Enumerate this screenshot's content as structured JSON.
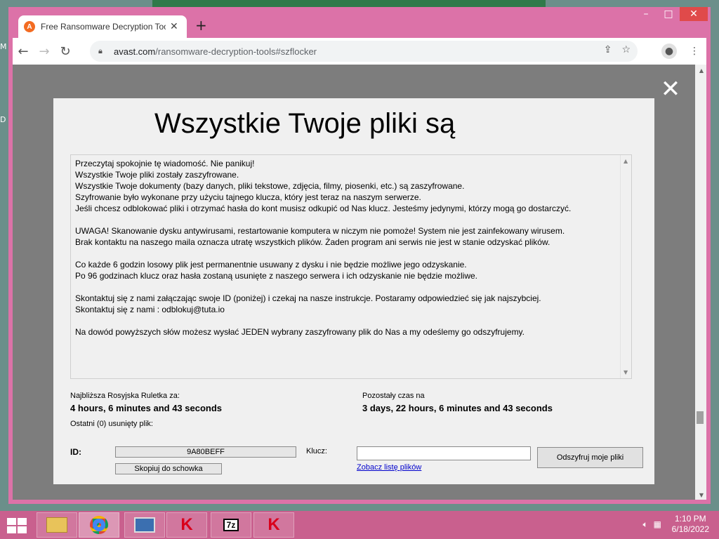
{
  "browser": {
    "tab_title": "Free Ransomware Decryption Tools",
    "tab_icon": "avast-logo-icon",
    "url_host": "avast.com",
    "url_path": "/ransomware-decryption-tools#szflocker",
    "window_controls": {
      "minimize": "–",
      "maximize": "□",
      "close": "✕"
    },
    "new_tab": "+",
    "accent": "#dc72a8"
  },
  "overlay": {
    "close_glyph": "✕"
  },
  "dialog": {
    "headline": "Wszystkie Twoje pliki są",
    "message": [
      "Przeczytaj spokojnie tę wiadomość. Nie panikuj!",
      "Wszystkie Twoje pliki zostały zaszyfrowane.",
      "Wszystkie Twoje dokumenty (bazy danych, pliki tekstowe, zdjęcia, filmy, piosenki, etc.) są zaszyfrowane.",
      "Szyfrowanie było wykonane przy użyciu tajnego klucza, który jest teraz na naszym serwerze.",
      "Jeśli chcesz odblokować pliki i otrzymać hasła do kont musisz odkupić od Nas klucz. Jesteśmy jedynymi, którzy mogą go dostarczyć.",
      "",
      "UWAGA! Skanowanie dysku antywirusami, restartowanie komputera w niczym nie pomoże! System nie jest zainfekowany wirusem.",
      "Brak kontaktu na naszego maila oznacza utratę wszystkich plików. Żaden program ani serwis nie jest w stanie odzyskać plików.",
      "",
      "Co każde 6 godzin losowy plik jest permanentnie usuwany z dysku i nie będzie możliwe jego odzyskanie.",
      "Po 96 godzinach klucz oraz hasła zostaną usunięte z naszego serwera i ich odzyskanie nie będzie możliwe.",
      "",
      "Skontaktuj się z nami załączając swoje ID (poniżej) i czekaj na nasze instrukcje. Postaramy odpowiedzieć się jak najszybciej.",
      "Skontaktuj się z nami : odblokuj@tuta.io",
      "",
      "Na dowód powyższych słów możesz wysłać JEDEN wybrany zaszyfrowany plik do Nas a my odeślemy go odszyfrujemy."
    ],
    "roulette_label": "Najbliższa Rosyjska Ruletka za:",
    "roulette_value": "4 hours, 6 minutes and 43 seconds",
    "remaining_label": "Pozostały czas na",
    "remaining_value": "3 days, 22 hours, 6 minutes and 43 seconds",
    "deleted_label": "Ostatni (0) usunięty plik:",
    "id_label": "ID:",
    "id_value": "9A80BEFF",
    "copy_button": "Skopiuj do schowka",
    "key_label": "Klucz:",
    "key_value": "",
    "files_link": "Zobacz listę plików",
    "decrypt_button": "Odszyfruj moje pliki"
  },
  "taskbar": {
    "time": "1:10 PM",
    "date": "6/18/2022",
    "apps": [
      "file-explorer-icon",
      "chrome-icon",
      "computer-icon",
      "kaspersky-icon",
      "7zip-icon",
      "kaspersky-icon"
    ],
    "app_text": {
      "sevenzip": "7z"
    }
  }
}
